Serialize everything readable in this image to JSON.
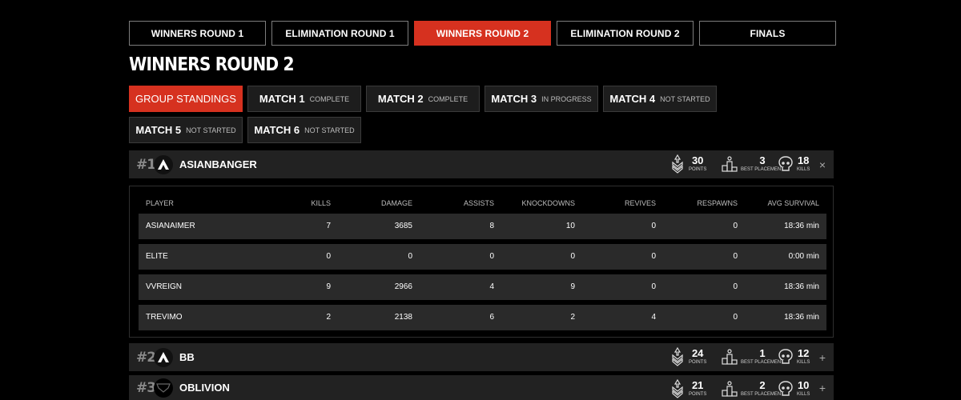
{
  "round_tabs": [
    {
      "label": "WINNERS ROUND 1",
      "active": false
    },
    {
      "label": "ELIMINATION ROUND 1",
      "active": false
    },
    {
      "label": "WINNERS ROUND 2",
      "active": true
    },
    {
      "label": "ELIMINATION ROUND 2",
      "active": false
    },
    {
      "label": "FINALS",
      "active": false
    }
  ],
  "page_title": "WINNERS ROUND 2",
  "match_tabs": [
    {
      "label": "GROUP STANDINGS",
      "status": "",
      "active": true
    },
    {
      "label": "MATCH 1",
      "status": "COMPLETE",
      "active": false
    },
    {
      "label": "MATCH 2",
      "status": "COMPLETE",
      "active": false
    },
    {
      "label": "MATCH 3",
      "status": "IN PROGRESS",
      "active": false
    },
    {
      "label": "MATCH 4",
      "status": "NOT STARTED",
      "active": false
    },
    {
      "label": "MATCH 5",
      "status": "NOT STARTED",
      "active": false
    },
    {
      "label": "MATCH 6",
      "status": "NOT STARTED",
      "active": false
    }
  ],
  "stat_labels": {
    "points": "POINTS",
    "best": "BEST PLACEMENT",
    "kills": "KILLS"
  },
  "teams": [
    {
      "rank": "#1",
      "name": "ASIANBANGER",
      "points": "30",
      "best": "3",
      "kills": "18",
      "toggle": "×",
      "expanded": true
    },
    {
      "rank": "#2",
      "name": "BB",
      "points": "24",
      "best": "1",
      "kills": "12",
      "toggle": "+",
      "expanded": false
    },
    {
      "rank": "#3",
      "name": "OBLIVION",
      "points": "21",
      "best": "2",
      "kills": "10",
      "toggle": "+",
      "expanded": false
    }
  ],
  "player_columns": [
    "PLAYER",
    "KILLS",
    "DAMAGE",
    "ASSISTS",
    "KNOCKDOWNS",
    "REVIVES",
    "RESPAWNS",
    "AVG SURVIVAL"
  ],
  "players": [
    [
      "ASIANAIMER",
      "7",
      "3685",
      "8",
      "10",
      "0",
      "0",
      "18:36 min"
    ],
    [
      "ELITE",
      "0",
      "0",
      "0",
      "0",
      "0",
      "0",
      "0:00 min"
    ],
    [
      "VVREIGN",
      "9",
      "2966",
      "4",
      "9",
      "0",
      "0",
      "18:36 min"
    ],
    [
      "TREVIMO",
      "2",
      "2138",
      "6",
      "2",
      "4",
      "0",
      "18:36 min"
    ]
  ],
  "colors": {
    "accent": "#d6311f",
    "row": "#222222",
    "player_row": "#2a2a2a"
  }
}
